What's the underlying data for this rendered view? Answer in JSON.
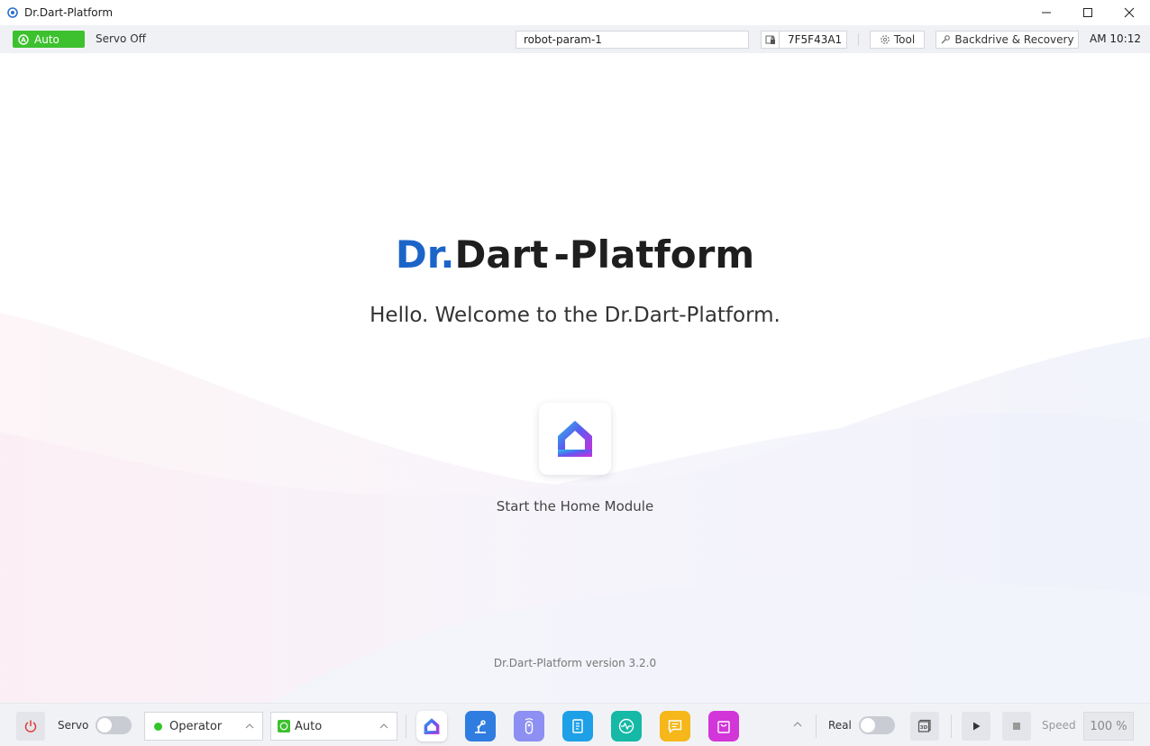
{
  "window": {
    "title": "Dr.Dart-Platform",
    "controls": [
      "minimize",
      "maximize",
      "close"
    ]
  },
  "statusbar": {
    "mode_badge": "Auto",
    "servo_status": "Servo Off",
    "param_value": "robot-param-1",
    "serial": "7F5F43A1",
    "tool_label": "Tool",
    "backdrive_label": "Backdrive & Recovery",
    "clock": "AM 10:12"
  },
  "main": {
    "logo": {
      "dr": "Dr.",
      "dart": "Dart",
      "platform": "-Platform"
    },
    "welcome": "Hello. Welcome to the Dr.Dart-Platform.",
    "home_label": "Start the Home Module",
    "version": "Dr.Dart-Platform version 3.2.0"
  },
  "bottombar": {
    "servo_label": "Servo",
    "servo_on": false,
    "user_role": "Operator",
    "mode": "Auto",
    "apps": [
      {
        "icon": "home-icon",
        "color": "#ffffff"
      },
      {
        "icon": "robot-arm-icon",
        "color": "#2f7de0"
      },
      {
        "icon": "remote-icon",
        "color": "#8d8ff2"
      },
      {
        "icon": "task-list-icon",
        "color": "#1ea0e6"
      },
      {
        "icon": "monitor-wave-icon",
        "color": "#16b8a6"
      },
      {
        "icon": "notes-icon",
        "color": "#f5b719"
      },
      {
        "icon": "store-bag-icon",
        "color": "#d235d8"
      }
    ],
    "real_label": "Real",
    "real_on": false,
    "speed_label": "Speed",
    "speed_value": "100 %"
  },
  "colors": {
    "accent_blue": "#1c64c8",
    "auto_green": "#3dc12f",
    "statusbar_bg": "#eff1f5",
    "bottombar_bg": "#f1f2f6"
  }
}
